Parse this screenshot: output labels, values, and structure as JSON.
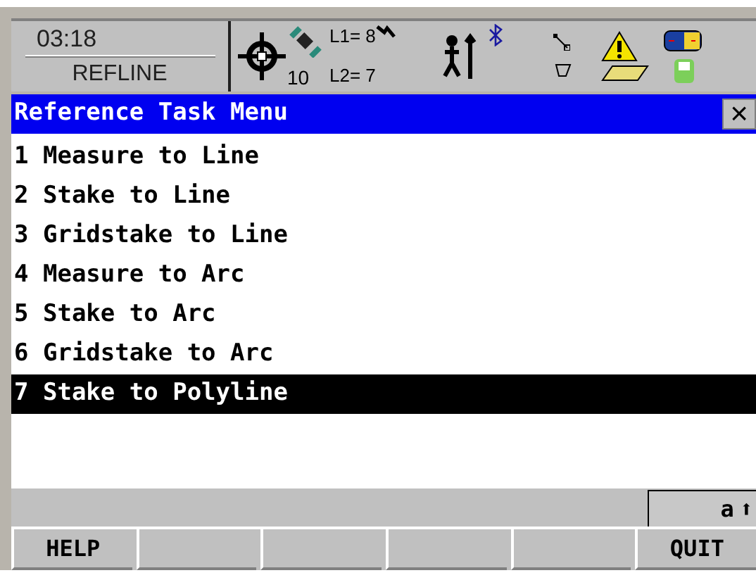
{
  "status": {
    "time": "03:18",
    "app": "REFLINE",
    "satellites": "10",
    "l1": "L1= 8",
    "l2": "L2= 7"
  },
  "window": {
    "title": "Reference Task Menu",
    "close": "×"
  },
  "menu": [
    {
      "number": "1",
      "label": "Measure to Line",
      "selected": false
    },
    {
      "number": "2",
      "label": "Stake to Line",
      "selected": false
    },
    {
      "number": "3",
      "label": "Gridstake to Line",
      "selected": false
    },
    {
      "number": "4",
      "label": "Measure to Arc",
      "selected": false
    },
    {
      "number": "5",
      "label": "Stake to Arc",
      "selected": false
    },
    {
      "number": "6",
      "label": "Gridstake to Arc",
      "selected": false
    },
    {
      "number": "7",
      "label": "Stake to Polyline",
      "selected": true
    }
  ],
  "input_mode": {
    "label": "a",
    "shift": "⬆"
  },
  "softkeys": [
    {
      "kind": "labeled",
      "label": "HELP"
    },
    {
      "kind": "blank"
    },
    {
      "kind": "blank"
    },
    {
      "kind": "blank"
    },
    {
      "kind": "blank"
    },
    {
      "kind": "labeled",
      "label": "QUIT"
    }
  ]
}
